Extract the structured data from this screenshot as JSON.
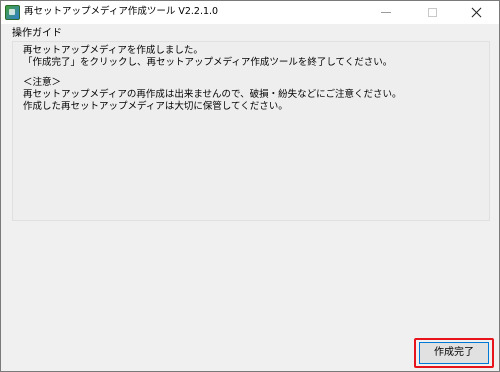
{
  "window": {
    "title": "再セットアップメディア作成ツール V2.2.1.0"
  },
  "guide": {
    "label": "操作ガイド",
    "lines": [
      "再セットアップメディアを作成しました。",
      "「作成完了」をクリックし、再セットアップメディア作成ツールを終了してください。",
      "",
      "＜注意＞",
      "再セットアップメディアの再作成は出来ませんので、破損・紛失などにご注意ください。",
      "作成した再セットアップメディアは大切に保管してください。"
    ]
  },
  "footer": {
    "finish_label": "作成完了",
    "highlight_color": "#e8141b"
  }
}
